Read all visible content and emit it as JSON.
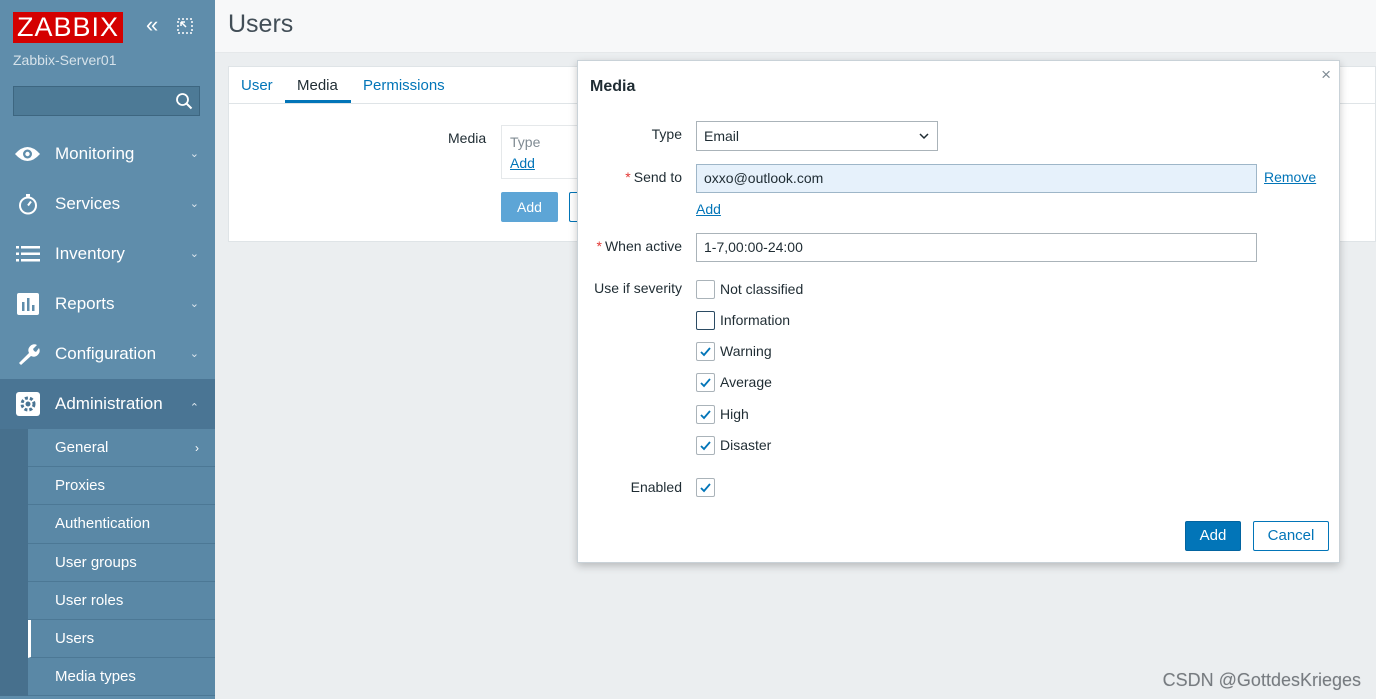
{
  "app": {
    "logo_text": "ZABBIX",
    "server_name": "Zabbix-Server01",
    "search_placeholder": ""
  },
  "sidebar": {
    "items": [
      {
        "label": "Monitoring",
        "icon": "eye-icon"
      },
      {
        "label": "Services",
        "icon": "stopwatch-icon"
      },
      {
        "label": "Inventory",
        "icon": "list-icon"
      },
      {
        "label": "Reports",
        "icon": "bar-chart-icon"
      },
      {
        "label": "Configuration",
        "icon": "wrench-icon"
      },
      {
        "label": "Administration",
        "icon": "gear-icon",
        "expanded": true
      }
    ],
    "admin_sub": [
      {
        "label": "General"
      },
      {
        "label": "Proxies"
      },
      {
        "label": "Authentication"
      },
      {
        "label": "User groups"
      },
      {
        "label": "User roles"
      },
      {
        "label": "Users",
        "selected": true
      },
      {
        "label": "Media types"
      }
    ]
  },
  "page": {
    "title": "Users",
    "tabs": [
      "User",
      "Media",
      "Permissions"
    ],
    "active_tab": "Media",
    "media_label": "Media",
    "media_table_header": "Type",
    "media_add_link": "Add",
    "add_button": "Add"
  },
  "modal": {
    "title": "Media",
    "close": "×",
    "type_label": "Type",
    "type_value": "Email",
    "send_to_label": "Send to",
    "send_to_value": "oxxo@outlook.com",
    "remove_link": "Remove",
    "add_link": "Add",
    "when_active_label": "When active",
    "when_active_value": "1-7,00:00-24:00",
    "severity_label": "Use if severity",
    "severities": [
      {
        "label": "Not classified",
        "checked": false
      },
      {
        "label": "Information",
        "checked": false
      },
      {
        "label": "Warning",
        "checked": true
      },
      {
        "label": "Average",
        "checked": true
      },
      {
        "label": "High",
        "checked": true
      },
      {
        "label": "Disaster",
        "checked": true
      }
    ],
    "enabled_label": "Enabled",
    "enabled_checked": true,
    "add_button": "Add",
    "cancel_button": "Cancel"
  },
  "watermark": "CSDN @GottdesKrieges",
  "colors": {
    "sidebar": "#5f8dab",
    "brand_red": "#d40000",
    "primary": "#0275b8",
    "required": "#e33734"
  }
}
